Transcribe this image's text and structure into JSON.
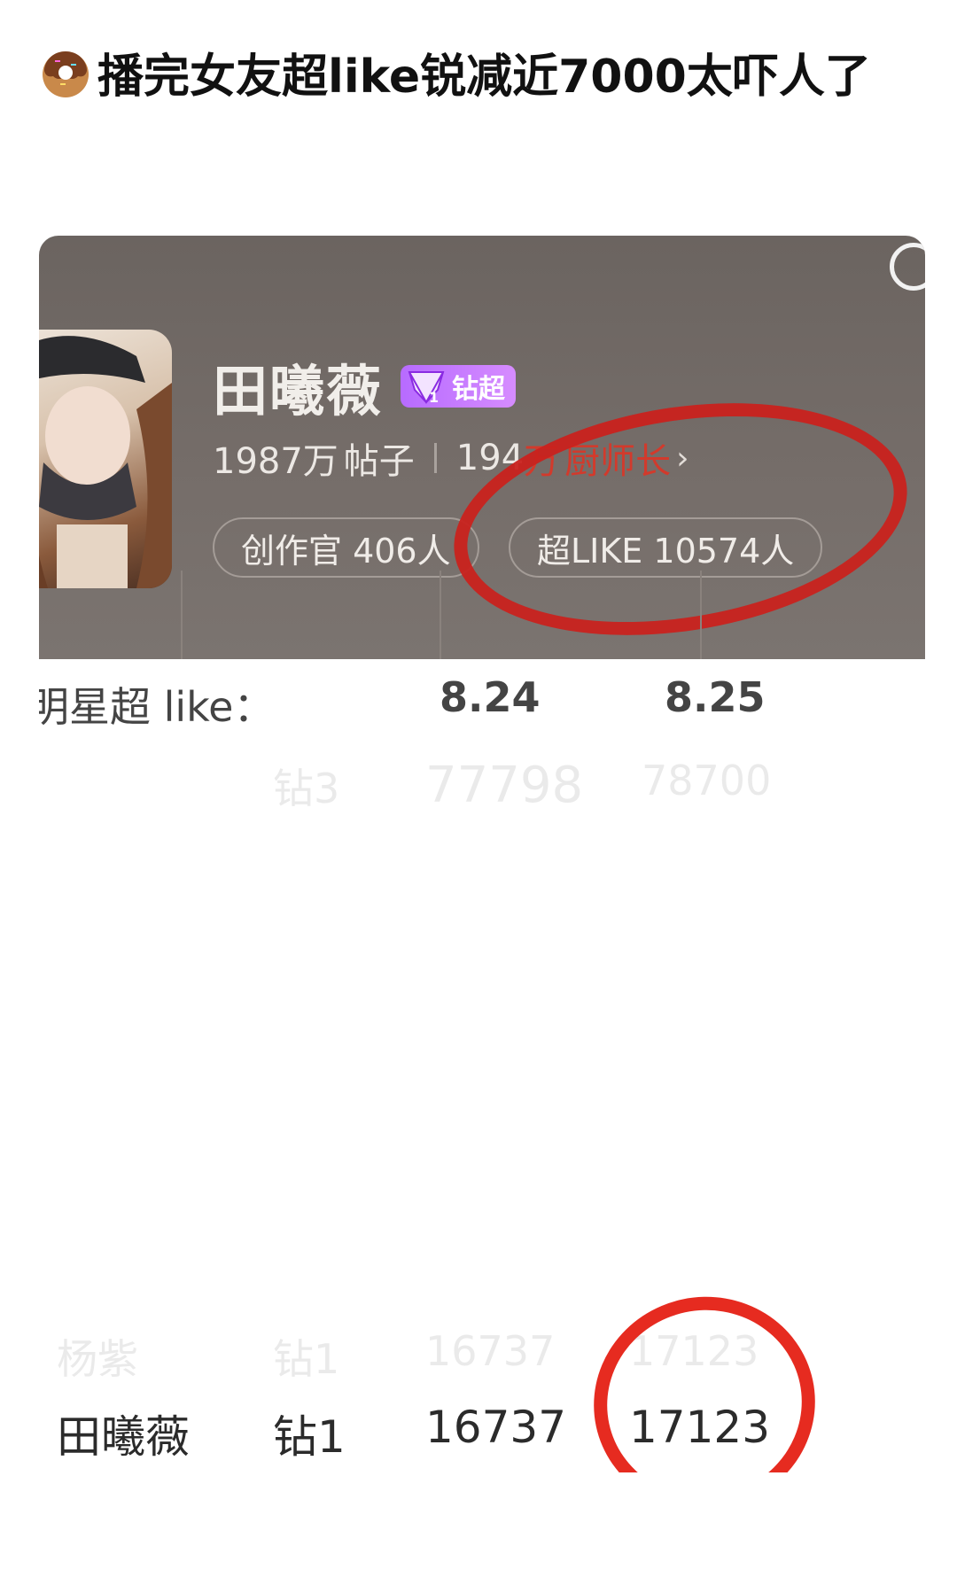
{
  "post": {
    "title": "播完女友超like锐减近7000太吓人了"
  },
  "profile": {
    "name": "田曦薇",
    "level_badge": "钻超",
    "stats": {
      "posts_value": "1987万",
      "posts_label": "帖子",
      "fans_value_a": "194",
      "fans_value_b": "万",
      "fans_label": "厨师长",
      "chevron": "›"
    },
    "pills": {
      "creator": "创作官 406人",
      "superlike": "超LIKE 10574人"
    }
  },
  "table": {
    "header": {
      "label": "明星超 like：",
      "date1": "8.24",
      "date2": "8.25"
    },
    "ghost_row_1": {
      "level": "钻3",
      "v1": "77798",
      "v2": "78700"
    },
    "ghost_row_2": {
      "name": "杨紫",
      "level": "钻1",
      "v1": "16737",
      "v2": "17123"
    },
    "row": {
      "name": "田曦薇",
      "level": "钻1",
      "v1": "16737",
      "v2": "17123"
    }
  },
  "colors": {
    "annotation_red": "#e62b20",
    "badge_purple": "#b76bff",
    "profile_bg": "#756d69"
  }
}
